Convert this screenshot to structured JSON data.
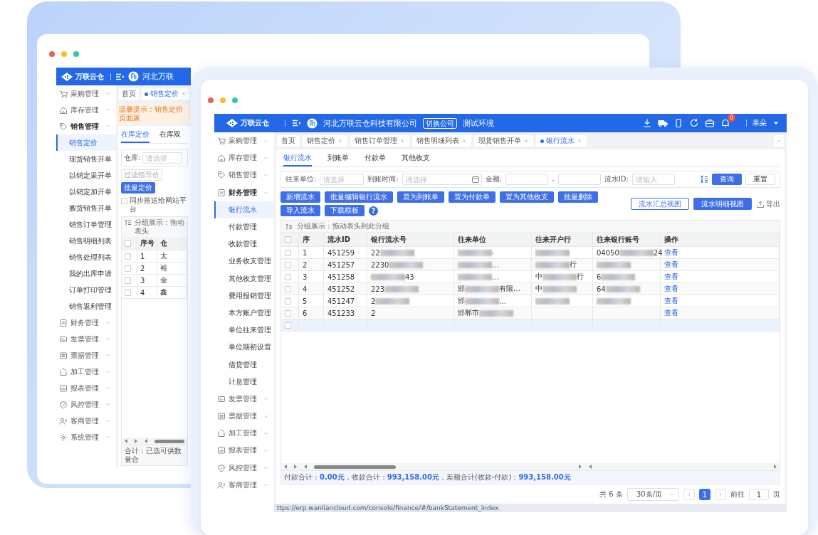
{
  "back_window": {
    "header": {
      "logo": "万联云仓",
      "company": "河北万联"
    },
    "sidebar": [
      {
        "label": "采购管理",
        "expanded": false
      },
      {
        "label": "库存管理",
        "expanded": false
      },
      {
        "label": "销售管理",
        "expanded": true,
        "children": [
          {
            "label": "销售定价",
            "selected": true
          },
          {
            "label": "现货销售开单",
            "selected": false
          },
          {
            "label": "以销定采开单",
            "selected": false
          },
          {
            "label": "以销定加开单",
            "selected": false
          },
          {
            "label": "搬货销售开单",
            "selected": false
          },
          {
            "label": "销售订单管理",
            "selected": false
          },
          {
            "label": "销售明细列表",
            "selected": false
          },
          {
            "label": "销售处理列表",
            "selected": false
          },
          {
            "label": "我的出库申请",
            "selected": false
          },
          {
            "label": "订单打印管理",
            "selected": false
          },
          {
            "label": "销售返利管理",
            "selected": false
          }
        ]
      },
      {
        "label": "财务管理",
        "expanded": false
      },
      {
        "label": "发票管理",
        "expanded": false
      },
      {
        "label": "票据管理",
        "expanded": false
      },
      {
        "label": "加工管理",
        "expanded": false
      },
      {
        "label": "报表管理",
        "expanded": false
      },
      {
        "label": "风控管理",
        "expanded": false
      },
      {
        "label": "客商管理",
        "expanded": false
      },
      {
        "label": "系统管理",
        "expanded": false
      }
    ],
    "tabs": [
      {
        "label": "首页",
        "selected": false,
        "closable": false
      },
      {
        "label": "销售定价",
        "selected": true,
        "closable": true
      }
    ],
    "notice": "温馨提示：销售定价页面展",
    "subtabs": [
      {
        "label": "在库定价",
        "selected": true
      },
      {
        "label": "在库双",
        "selected": false
      }
    ],
    "filter": {
      "label": "仓库:",
      "placeholder": "请选择"
    },
    "buttons": [
      {
        "label": "过滤指导价",
        "kind": "outline"
      },
      {
        "label": "批量定价",
        "kind": "primary"
      }
    ],
    "sync_checkbox": {
      "label": "同步推送给网站平台",
      "checked": false
    },
    "group_hint": "分组展示：拖动表头",
    "table": {
      "select_all_checked": false,
      "columns": [
        "序号",
        "仓"
      ],
      "rows": [
        {
          "checked": false,
          "cells": [
            "1",
            "太"
          ]
        },
        {
          "checked": false,
          "cells": [
            "2",
            "裕"
          ]
        },
        {
          "checked": false,
          "cells": [
            "3",
            "金"
          ]
        },
        {
          "checked": false,
          "cells": [
            "4",
            "鑫"
          ]
        }
      ]
    },
    "footer": "合计：已选可供数量合"
  },
  "front_window": {
    "header": {
      "logo": "万联云仓",
      "company": "河北万联云仓科技有限公司",
      "switch_button": "切换公司",
      "environment": "测试环境",
      "notification_count": "0",
      "user": "果朵"
    },
    "sidebar": [
      {
        "label": "采购管理",
        "expanded": false
      },
      {
        "label": "库存管理",
        "expanded": false
      },
      {
        "label": "销售管理",
        "expanded": false
      },
      {
        "label": "财务管理",
        "expanded": true,
        "children": [
          {
            "label": "银行流水",
            "selected": true
          },
          {
            "label": "付款管理",
            "selected": false
          },
          {
            "label": "收款管理",
            "selected": false
          },
          {
            "label": "业务收支管理",
            "selected": false
          },
          {
            "label": "其他收支管理",
            "selected": false
          },
          {
            "label": "费用报销管理",
            "selected": false
          },
          {
            "label": "本方账户管理",
            "selected": false
          },
          {
            "label": "单位往来管理",
            "selected": false
          },
          {
            "label": "单位期初设置",
            "selected": false
          },
          {
            "label": "借贷管理",
            "selected": false
          },
          {
            "label": "计息管理",
            "selected": false
          }
        ]
      },
      {
        "label": "发票管理",
        "expanded": false
      },
      {
        "label": "票据管理",
        "expanded": false
      },
      {
        "label": "加工管理",
        "expanded": false
      },
      {
        "label": "报表管理",
        "expanded": false
      },
      {
        "label": "风控管理",
        "expanded": false
      },
      {
        "label": "客商管理",
        "expanded": false
      }
    ],
    "tabs": [
      {
        "label": "首页",
        "selected": false,
        "closable": false
      },
      {
        "label": "销售定价",
        "selected": false,
        "closable": true
      },
      {
        "label": "销售订单管理",
        "selected": false,
        "closable": true
      },
      {
        "label": "销售明细列表",
        "selected": false,
        "closable": true
      },
      {
        "label": "现货销售开单",
        "selected": false,
        "closable": true
      },
      {
        "label": "银行流水",
        "selected": true,
        "closable": true
      }
    ],
    "subtabs": [
      {
        "label": "银行流水",
        "selected": true
      },
      {
        "label": "到账单",
        "selected": false
      },
      {
        "label": "付款单",
        "selected": false
      },
      {
        "label": "其他收支",
        "selected": false
      }
    ],
    "filters": [
      {
        "kind": "select",
        "label": "往来单位:",
        "placeholder": "请选择"
      },
      {
        "kind": "date",
        "label": "到账时间:",
        "placeholder": "请选择"
      },
      {
        "kind": "range",
        "label": "金额:",
        "separator": "-"
      },
      {
        "kind": "text",
        "label": "流水ID:",
        "placeholder": "请输入"
      }
    ],
    "search_button": "查询",
    "reset_button": "重置",
    "actions": [
      "新增流水",
      "批量编辑银行流水",
      "置为到账单",
      "置为付款单",
      "置为其他收支",
      "批量删除",
      "导入流水",
      "下载模板"
    ],
    "help": "?",
    "views": [
      {
        "label": "流水汇总视图",
        "selected": false
      },
      {
        "label": "流水明细视图",
        "selected": true
      }
    ],
    "export": "导出",
    "group_hint": "分组展示：拖动表头到此分组",
    "table": {
      "select_all_checked": false,
      "columns": [
        "序",
        "流水ID",
        "银行流水号",
        "往来单位",
        "往来开户行",
        "往来银行账号",
        "操作"
      ],
      "rows": [
        {
          "checked": false,
          "highlighted": false,
          "cells": [
            "1",
            "451259",
            {
              "text": "22",
              "blur": true
            },
            {
              "blur": true,
              "tail": "·"
            },
            {
              "blur": true
            },
            {
              "text": "04050",
              "blur": true,
              "tail": "24"
            },
            "查看"
          ]
        },
        {
          "checked": false,
          "highlighted": false,
          "cells": [
            "2",
            "451257",
            {
              "text": "2230",
              "blur": true
            },
            {
              "blur": true,
              "tail": "…"
            },
            {
              "blur": true,
              "tail": "行"
            },
            {
              "blur": true
            },
            "查看"
          ]
        },
        {
          "checked": false,
          "highlighted": false,
          "cells": [
            "3",
            "451258",
            {
              "blur": true,
              "tail": "43"
            },
            {
              "blur": true,
              "tail": "…"
            },
            {
              "text": "中",
              "blur": true,
              "tail": "行"
            },
            {
              "text": "6",
              "blur": true
            },
            "查看"
          ]
        },
        {
          "checked": false,
          "highlighted": false,
          "cells": [
            "4",
            "451252",
            {
              "text": "223",
              "blur": true
            },
            {
              "text": "邯",
              "blur": true,
              "tail": "有限…"
            },
            {
              "text": "中",
              "blur": true
            },
            {
              "text": "64",
              "blur": true
            },
            "查看"
          ]
        },
        {
          "checked": false,
          "highlighted": false,
          "cells": [
            "5",
            "451247",
            {
              "text": "2",
              "blur": true
            },
            {
              "text": "邯",
              "blur": true,
              "tail": "…"
            },
            {
              "blur": true
            },
            {
              "blur": true
            },
            "查看"
          ]
        },
        {
          "checked": false,
          "highlighted": false,
          "cells": [
            "6",
            "451233",
            "2",
            {
              "text": "邯郸市",
              "blur": true
            },
            "",
            "",
            "查看"
          ]
        },
        {
          "checked": false,
          "highlighted": true,
          "cells": []
        }
      ]
    },
    "totals": [
      {
        "label": "付款合计：",
        "value": "0.00元"
      },
      {
        "label": "，收款合计：",
        "value": "993,158.00元"
      },
      {
        "label": "，差额合计(收款-付款)：",
        "value": "993,158.00元"
      }
    ],
    "pagination": {
      "total": "共 6 条",
      "page_size": "30条/页",
      "pages": [
        {
          "label": "1",
          "selected": true
        }
      ],
      "goto_label": "前往",
      "goto_value": "1",
      "page_unit": "页"
    },
    "status_url": "ttps://erp.wanliancloud.com/console/finance/#/bankStatement_index"
  }
}
